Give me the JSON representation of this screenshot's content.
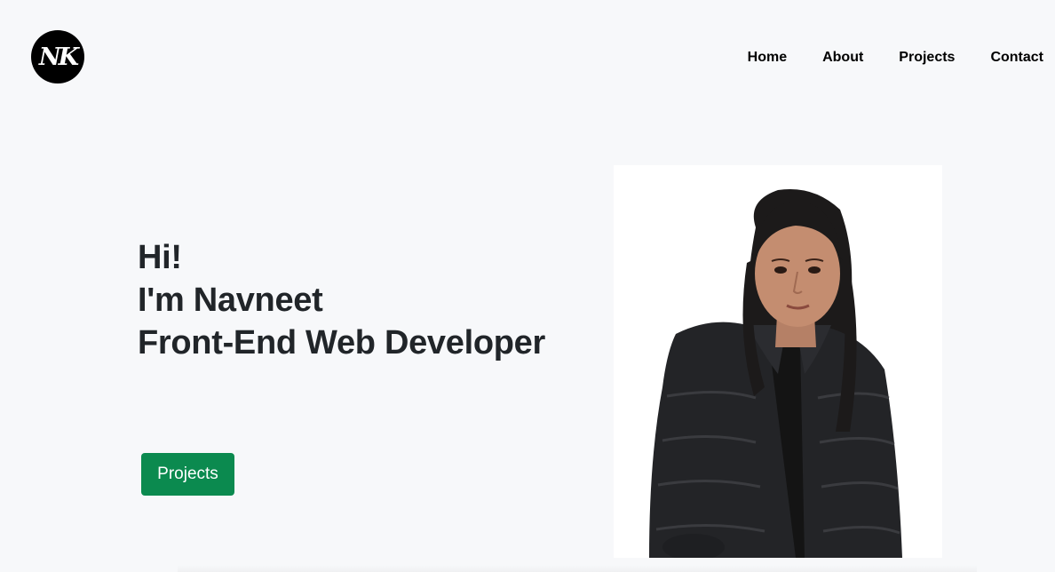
{
  "logo": {
    "text": "NK"
  },
  "nav": {
    "items": [
      {
        "label": "Home"
      },
      {
        "label": "About"
      },
      {
        "label": "Projects"
      },
      {
        "label": "Contact"
      }
    ]
  },
  "hero": {
    "greeting": "Hi!",
    "name_line": "I'm Navneet",
    "role": "Front-End Web Developer",
    "cta_label": "Projects"
  },
  "colors": {
    "background": "#f7f8fa",
    "cta": "#0b8a4f",
    "heading": "#212529"
  }
}
